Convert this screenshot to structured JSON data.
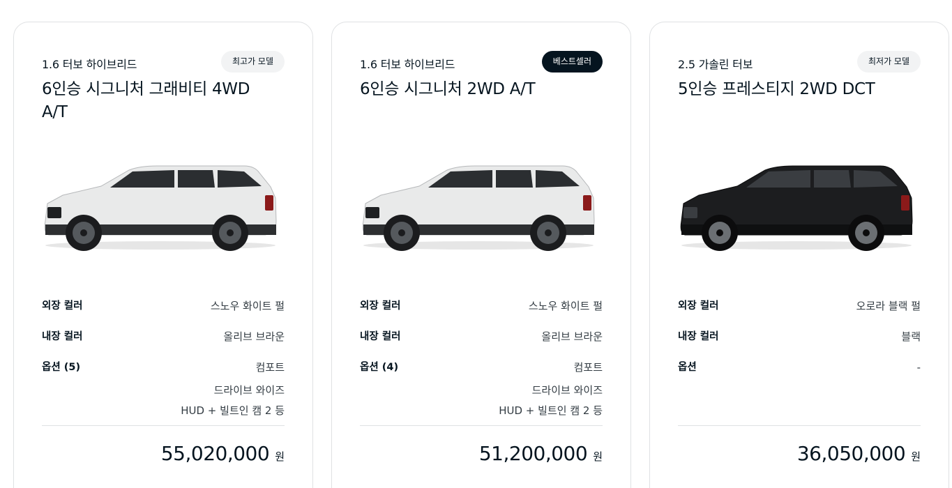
{
  "cards": [
    {
      "engine": "1.6 터보 하이브리드",
      "badge": "최고가 모델",
      "badge_style": "light",
      "trim": "6인승 시그니처 그래비티 4WD A/T",
      "car_color": "#e9eaea",
      "car_image_alt": "white-suv-side-view",
      "specs": {
        "exterior_label": "외장 컬러",
        "exterior_value": "스노우 화이트 펄",
        "interior_label": "내장 컬러",
        "interior_value": "올리브 브라운",
        "options_label": "옵션 (5)",
        "options_values": [
          "컴포트",
          "드라이브 와이즈",
          "HUD + 빌트인 캠 2 등"
        ]
      },
      "price": "55,020,000",
      "price_unit": "원"
    },
    {
      "engine": "1.6 터보 하이브리드",
      "badge": "베스트셀러",
      "badge_style": "dark",
      "trim": "6인승 시그니처 2WD A/T",
      "car_color": "#e9eaea",
      "car_image_alt": "white-suv-side-view",
      "specs": {
        "exterior_label": "외장 컬러",
        "exterior_value": "스노우 화이트 펄",
        "interior_label": "내장 컬러",
        "interior_value": "올리브 브라운",
        "options_label": "옵션 (4)",
        "options_values": [
          "컴포트",
          "드라이브 와이즈",
          "HUD + 빌트인 캠 2 등"
        ]
      },
      "price": "51,200,000",
      "price_unit": "원"
    },
    {
      "engine": "2.5 가솔린 터보",
      "badge": "최저가 모델",
      "badge_style": "light",
      "trim": "5인승 프레스티지 2WD DCT",
      "car_color": "#1c1d1f",
      "car_image_alt": "black-suv-side-view",
      "specs": {
        "exterior_label": "외장 컬러",
        "exterior_value": "오로라 블랙 펄",
        "interior_label": "내장 컬러",
        "interior_value": "블랙",
        "options_label": "옵션",
        "options_values": [
          "-"
        ]
      },
      "price": "36,050,000",
      "price_unit": "원"
    }
  ]
}
